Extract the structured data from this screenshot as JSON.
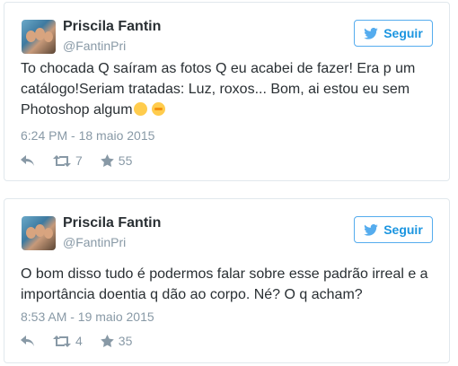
{
  "tweets": [
    {
      "name": "Priscila Fantin",
      "handle": "@FantinPri",
      "follow_label": "Seguir",
      "text": "To chocada Q saíram as fotos Q eu acabei de fazer! Era p um catálogo!Seriam tratadas: Luz, roxos... Bom, ai estou eu sem Photoshop algum",
      "emojis": [
        "wink-emoji",
        "flushed-emoji"
      ],
      "date": "6:24 PM - 18 maio 2015",
      "retweets": "7",
      "favorites": "55"
    },
    {
      "name": "Priscila Fantin",
      "handle": "@FantinPri",
      "follow_label": "Seguir",
      "text": "O bom disso tudo é podermos falar sobre esse padrão irreal e a importância doentia q dão ao corpo. Né? O q acham?",
      "emojis": [],
      "date": "8:53 AM - 19 maio 2015",
      "retweets": "4",
      "favorites": "35"
    }
  ],
  "colors": {
    "accent": "#55acee",
    "muted": "#8899a6",
    "text": "#292f33",
    "border": "#e1e8ed"
  },
  "icons": {
    "follow": "twitter-bird-icon",
    "reply": "reply-icon",
    "retweet": "retweet-icon",
    "favorite": "star-icon"
  }
}
